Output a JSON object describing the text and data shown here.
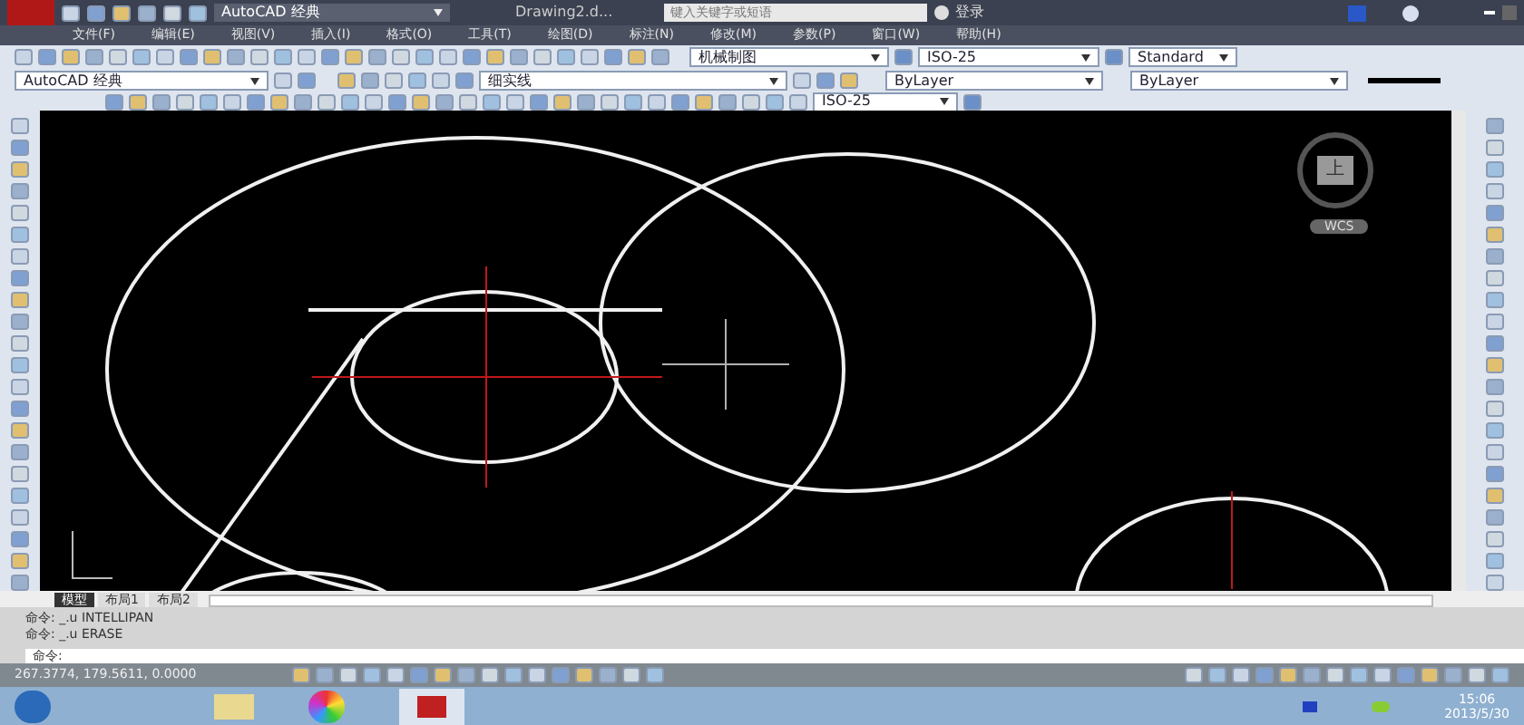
{
  "window": {
    "workspace": "AutoCAD 经典",
    "title": "Drawing2.d...",
    "search": {
      "placeholder": "键入关键字或短语"
    },
    "login": "登录"
  },
  "menu": [
    "文件(F)",
    "编辑(E)",
    "视图(V)",
    "插入(I)",
    "格式(O)",
    "工具(T)",
    "绘图(D)",
    "标注(N)",
    "修改(M)",
    "参数(P)",
    "窗口(W)",
    "帮助(H)"
  ],
  "styles": {
    "workspace": "AutoCAD 经典",
    "text_style": "机械制图",
    "dim_style": "ISO-25",
    "table_style": "Standard"
  },
  "layers": {
    "layer": "细实线",
    "color_setting": "ByLayer",
    "linetype": "ByLayer"
  },
  "dim_toolbar": {
    "dim_style": "ISO-25"
  },
  "viewcube": {
    "face": "上",
    "wcs": "WCS"
  },
  "layout_tabs": [
    {
      "label": "模型",
      "selected": true
    },
    {
      "label": "布局1",
      "selected": false
    },
    {
      "label": "布局2",
      "selected": false
    }
  ],
  "command_history": [
    "命令: _.u INTELLIPAN",
    "命令: _.u ERASE"
  ],
  "command_prompt": "命令:",
  "status_bar": {
    "coordinates": "267.3774, 179.5611, 0.0000"
  },
  "taskbar": {
    "time": "15:06",
    "date": "2013/5/30"
  }
}
